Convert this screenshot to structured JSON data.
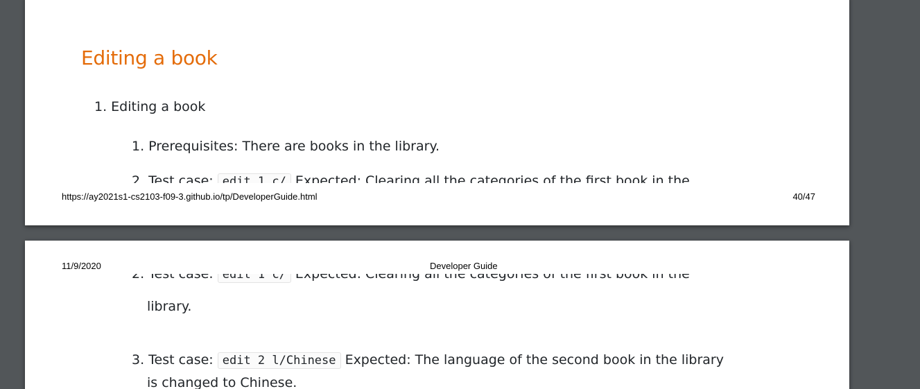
{
  "page1": {
    "heading": "Editing a book",
    "item1": "1. Editing a book",
    "sub1": "1. Prerequisites: There are books in the library.",
    "sub2_prefix": "2. Test case:",
    "sub2_code": "edit 1 c/",
    "sub2_suffix": "Expected: Clearing all the categories of the first book in the",
    "footer_url": "https://ay2021s1-cs2103-f09-3.github.io/tp/DeveloperGuide.html",
    "footer_page": "40/47"
  },
  "page2": {
    "header_date": "11/9/2020",
    "header_title": "Developer Guide",
    "sub2_prefix": "2. Test case:",
    "sub2_code": "edit 1 c/",
    "sub2_suffix": "Expected: Clearing all the categories of the first book in the",
    "sub2_cont": "library.",
    "sub3_prefix": "3. Test case:",
    "sub3_code": "edit 2 l/Chinese",
    "sub3_suffix": "Expected: The language of the second book in the library",
    "sub3_cont": "is changed to Chinese."
  }
}
